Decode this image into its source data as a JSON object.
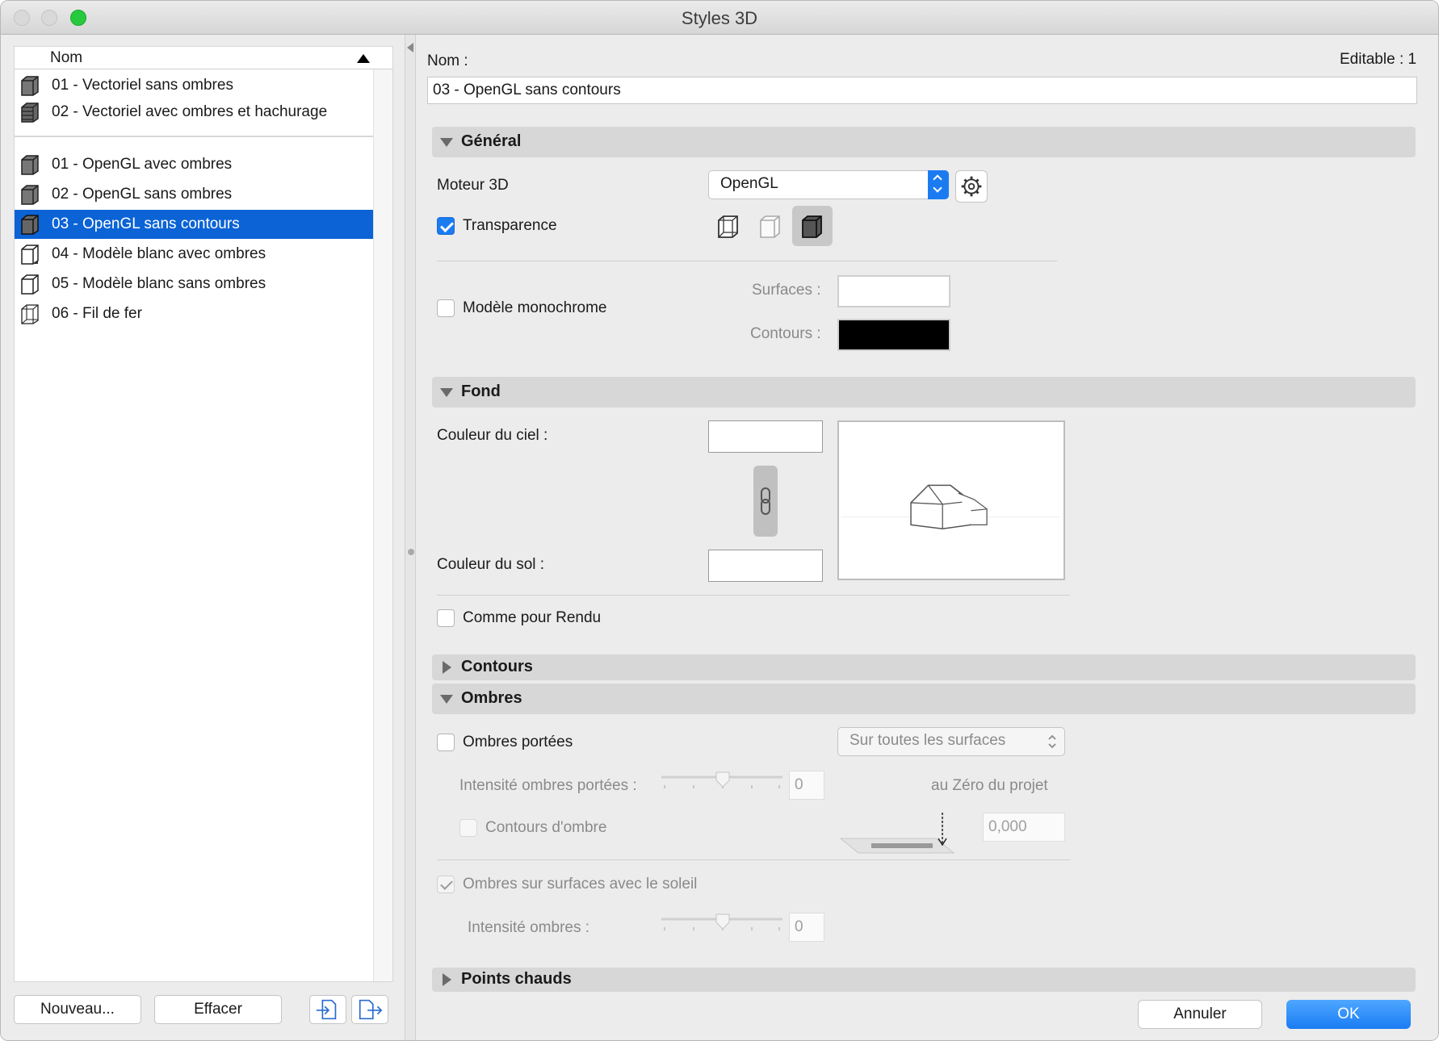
{
  "window": {
    "title": "Styles 3D"
  },
  "list": {
    "header": "Nom",
    "group1": [
      {
        "label": "01 - Vectoriel sans ombres"
      },
      {
        "label": "02 - Vectoriel avec ombres et hachurage"
      }
    ],
    "group2": [
      {
        "label": "01 - OpenGL avec ombres"
      },
      {
        "label": "02 - OpenGL sans ombres"
      },
      {
        "label": "03 - OpenGL sans contours",
        "selected": true
      },
      {
        "label": "04 - Modèle blanc avec ombres"
      },
      {
        "label": "05 - Modèle blanc sans ombres"
      },
      {
        "label": "06 - Fil de fer"
      }
    ],
    "new_button": "Nouveau...",
    "delete_button": "Effacer"
  },
  "form": {
    "name_label": "Nom :",
    "name_value": "03 - OpenGL sans contours",
    "editable": "Editable : 1",
    "general": {
      "title": "Général",
      "engine_label": "Moteur 3D",
      "engine_value": "OpenGL",
      "transparency_label": "Transparence",
      "transparency_checked": true,
      "monochrome_label": "Modèle monochrome",
      "monochrome_checked": false,
      "surfaces_label": "Surfaces :",
      "surfaces_color": "#ffffff",
      "contours_label": "Contours :",
      "contours_color": "#000000"
    },
    "background": {
      "title": "Fond",
      "sky_label": "Couleur du ciel :",
      "sky_color": "#ffffff",
      "ground_label": "Couleur du sol :",
      "ground_color": "#ffffff",
      "like_render_label": "Comme pour Rendu",
      "like_render_checked": false
    },
    "contours": {
      "title": "Contours"
    },
    "shadows": {
      "title": "Ombres",
      "cast_label": "Ombres portées",
      "cast_checked": false,
      "cast_mode": "Sur toutes les surfaces",
      "cast_intensity_label": "Intensité ombres portées :",
      "cast_intensity_value": "0",
      "project_zero_label": "au Zéro du projet",
      "shadow_contours_label": "Contours d'ombre",
      "shadow_contours_checked": false,
      "elevation_value": "0,000",
      "sun_label": "Ombres sur surfaces avec le soleil",
      "sun_checked": true,
      "intensity_label": "Intensité ombres :",
      "intensity_value": "0"
    },
    "hotspots": {
      "title": "Points chauds"
    }
  },
  "footer": {
    "cancel": "Annuler",
    "ok": "OK"
  },
  "colors": {
    "accent": "#0b63d6",
    "section_header": "#d7d7d7"
  }
}
